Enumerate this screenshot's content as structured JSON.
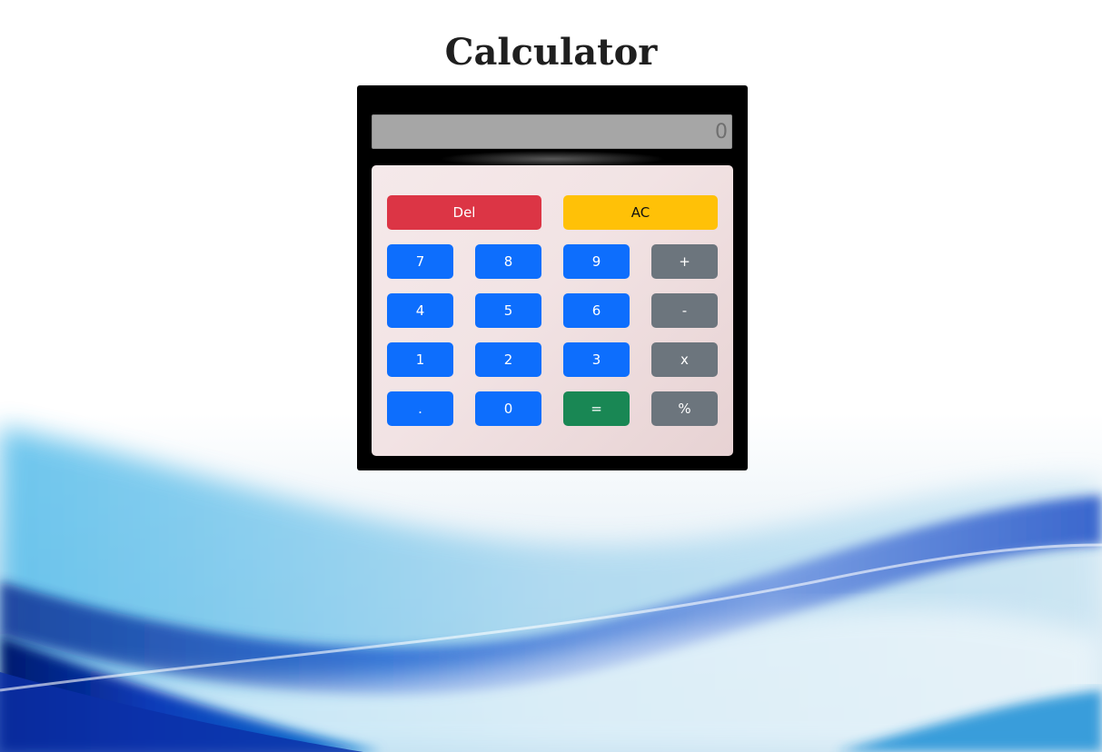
{
  "title": "Calculator",
  "display": {
    "value": "0"
  },
  "buttons": {
    "del": "Del",
    "ac": "AC",
    "seven": "7",
    "eight": "8",
    "nine": "9",
    "plus": "+",
    "four": "4",
    "five": "5",
    "six": "6",
    "minus": "-",
    "one": "1",
    "two": "2",
    "three": "3",
    "multiply": "x",
    "dot": ".",
    "zero": "0",
    "equals": "=",
    "percent": "%"
  },
  "colors": {
    "del": "#dc3545",
    "ac": "#ffc107",
    "digit": "#0d6efd",
    "operator": "#6c757d",
    "equals": "#198754",
    "calculator_body": "#000000",
    "display_bg": "#a6a6a6"
  }
}
